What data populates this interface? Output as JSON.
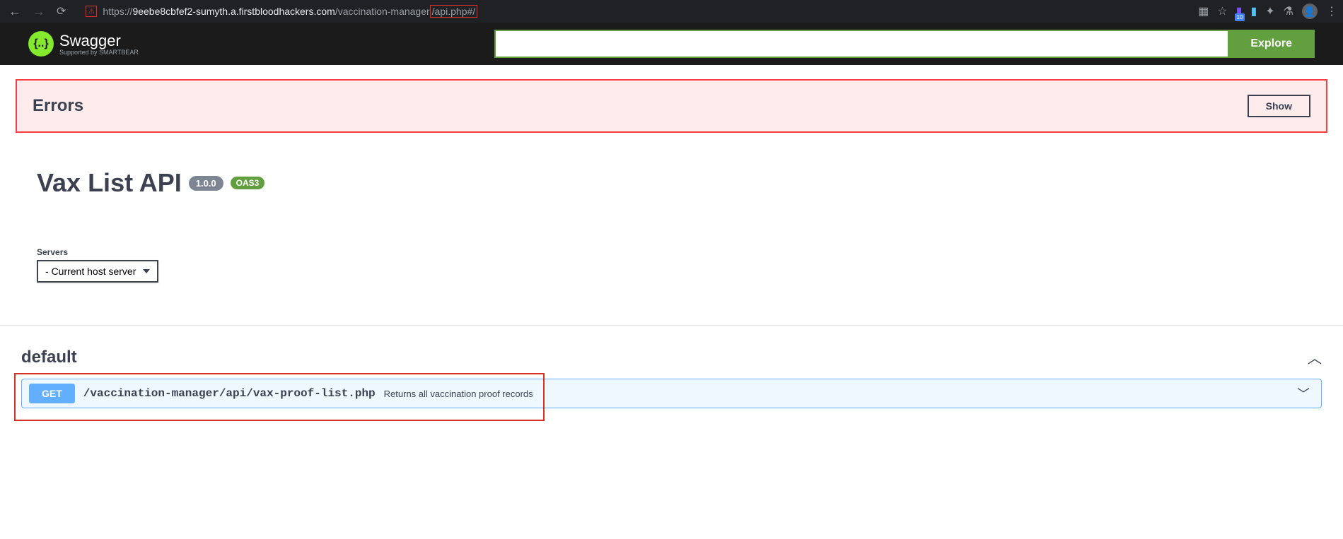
{
  "browser": {
    "url_scheme": "https://",
    "url_domain": "9eebe8cbfef2-sumyth.a.firstbloodhackers.com",
    "url_path_before": "/vaccination-manager",
    "url_path_highlight": "/api.php#/",
    "ext_badge": "10"
  },
  "swagger": {
    "brand": "Swagger",
    "sub": "Supported by SMARTBEAR",
    "logo_glyph": "{..}",
    "search_value": "",
    "explore_label": "Explore"
  },
  "errors": {
    "title": "Errors",
    "show_label": "Show"
  },
  "api": {
    "title": "Vax List API",
    "version": "1.0.0",
    "oas": "OAS3"
  },
  "servers": {
    "label": "Servers",
    "selected": " - Current host server"
  },
  "section": {
    "name": "default"
  },
  "endpoint": {
    "method": "GET",
    "path": "/vaccination-manager/api/vax-proof-list.php",
    "description": "Returns all vaccination proof records"
  }
}
